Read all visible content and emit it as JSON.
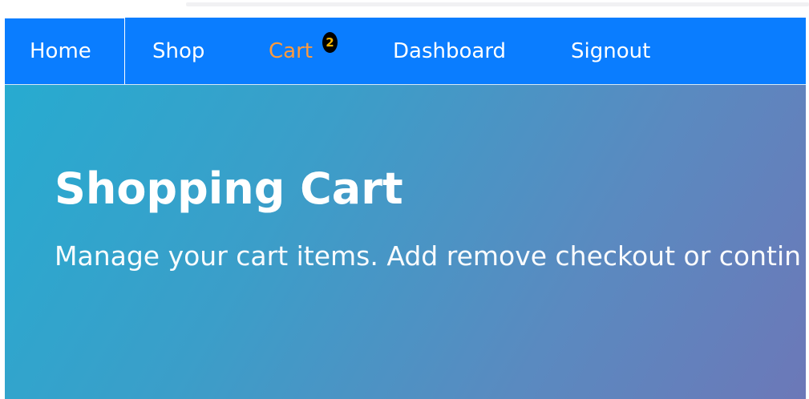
{
  "navbar": {
    "items": [
      {
        "label": "Home"
      },
      {
        "label": "Shop"
      },
      {
        "label": "Cart"
      },
      {
        "label": "Dashboard"
      },
      {
        "label": "Signout"
      }
    ],
    "cart_badge_count": "2",
    "colors": {
      "background": "#0a7dff",
      "active_item": "#ff9a3c",
      "badge_background": "#000000",
      "badge_text": "#f7b500"
    }
  },
  "hero": {
    "title": "Shopping Cart",
    "subtitle": "Manage your cart items. Add remove checkout or contin"
  }
}
